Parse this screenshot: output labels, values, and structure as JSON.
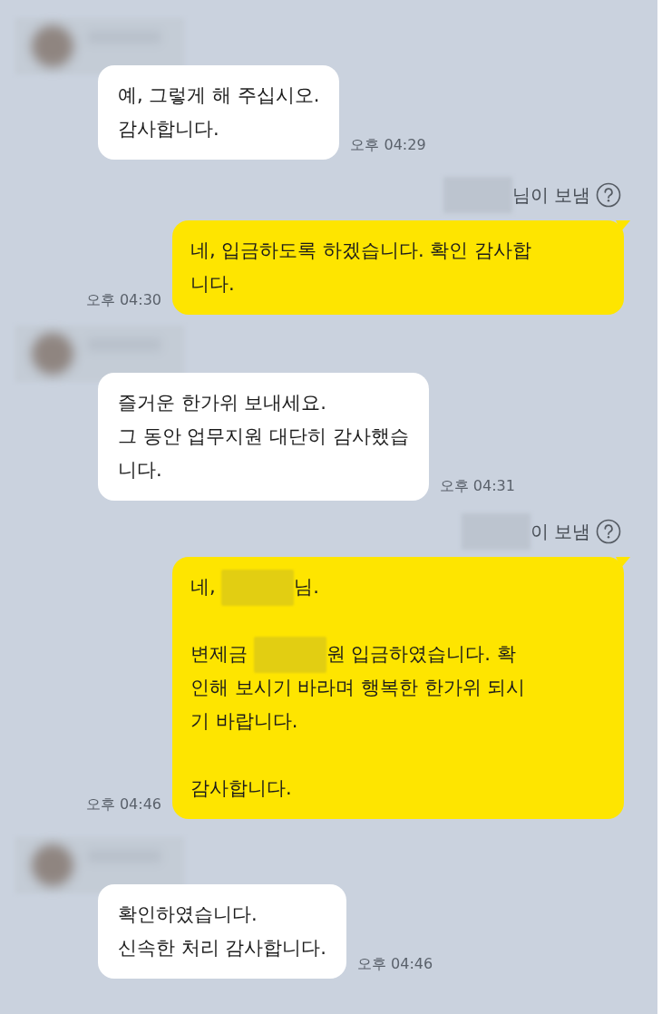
{
  "messages": [
    {
      "kind": "received",
      "paragraphs": [
        [
          [
            {
              "kind": "text",
              "text": "예, 그렇게 해 주십시오."
            }
          ],
          [
            {
              "kind": "text",
              "text": "감사합니다."
            }
          ]
        ]
      ],
      "time": "오후 04:29"
    },
    {
      "kind": "sent",
      "sender_note": "님이 보냄",
      "paragraphs": [
        [
          [
            {
              "kind": "text",
              "text": "네, 입금하도록 하겠습니다. 확인 감사합"
            }
          ],
          [
            {
              "kind": "text",
              "text": "니다."
            }
          ]
        ]
      ],
      "time": "오후 04:30"
    },
    {
      "kind": "received",
      "paragraphs": [
        [
          [
            {
              "kind": "text",
              "text": "즐거운 한가위 보내세요."
            }
          ],
          [
            {
              "kind": "text",
              "text": "그 동안 업무지원 대단히 감사했습"
            }
          ],
          [
            {
              "kind": "text",
              "text": "니다."
            }
          ]
        ]
      ],
      "time": "오후 04:31"
    },
    {
      "kind": "sent",
      "sender_note": "이 보냄",
      "paragraphs": [
        [
          [
            {
              "kind": "text",
              "text": "네, "
            },
            {
              "kind": "redacted"
            },
            {
              "kind": "text",
              "text": "님."
            }
          ]
        ],
        [
          [
            {
              "kind": "text",
              "text": "변제금 "
            },
            {
              "kind": "redacted"
            },
            {
              "kind": "text",
              "text": "원 입금하였습니다. 확"
            }
          ],
          [
            {
              "kind": "text",
              "text": "인해 보시기 바라며 행복한 한가위 되시"
            }
          ],
          [
            {
              "kind": "text",
              "text": "기 바랍니다."
            }
          ]
        ],
        [
          [
            {
              "kind": "text",
              "text": "감사합니다."
            }
          ]
        ]
      ],
      "time": "오후 04:46"
    },
    {
      "kind": "received",
      "paragraphs": [
        [
          [
            {
              "kind": "text",
              "text": "확인하였습니다."
            }
          ],
          [
            {
              "kind": "text",
              "text": "신속한 처리 감사합니다."
            }
          ]
        ]
      ],
      "time": "오후 04:46"
    }
  ]
}
